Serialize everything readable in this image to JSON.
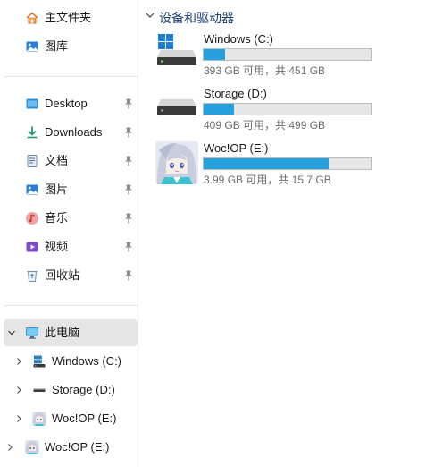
{
  "sidebar": {
    "quick_access": [
      {
        "label": "主文件夹",
        "icon": "home-icon",
        "pinned": false
      },
      {
        "label": "图库",
        "icon": "gallery-icon",
        "pinned": false
      }
    ],
    "pinned_folders": [
      {
        "label": "Desktop",
        "icon": "desktop-folder-icon"
      },
      {
        "label": "Downloads",
        "icon": "downloads-icon"
      },
      {
        "label": "文档",
        "icon": "documents-icon"
      },
      {
        "label": "图片",
        "icon": "pictures-icon"
      },
      {
        "label": "音乐",
        "icon": "music-icon"
      },
      {
        "label": "视频",
        "icon": "videos-icon"
      },
      {
        "label": "回收站",
        "icon": "recycle-bin-icon"
      }
    ],
    "this_pc": {
      "label": "此电脑",
      "icon": "this-pc-icon",
      "expanded": true
    },
    "this_pc_children": [
      {
        "label": "Windows (C:)",
        "icon": "windows-drive-icon"
      },
      {
        "label": "Storage (D:)",
        "icon": "hard-drive-icon"
      },
      {
        "label": "Woc!OP (E:)",
        "icon": "anime-avatar-drive-icon"
      }
    ],
    "root_drive": {
      "label": "Woc!OP (E:)",
      "icon": "anime-avatar-drive-icon"
    }
  },
  "main": {
    "section_title": "设备和驱动器",
    "drives": [
      {
        "name": "Windows (C:)",
        "free_text": "393 GB 可用，共 451 GB",
        "used_fraction": 0.129,
        "icon": "windows-drive-icon"
      },
      {
        "name": "Storage (D:)",
        "free_text": "409 GB 可用，共 499 GB",
        "used_fraction": 0.18,
        "icon": "hard-drive-icon"
      },
      {
        "name": "Woc!OP (E:)",
        "free_text": "3.99 GB 可用，共 15.7 GB",
        "used_fraction": 0.746,
        "icon": "anime-avatar-drive-icon"
      }
    ]
  },
  "colors": {
    "accent": "#26a0da",
    "header_text": "#1f3d7a",
    "selected_bg": "#e5e5e5"
  }
}
